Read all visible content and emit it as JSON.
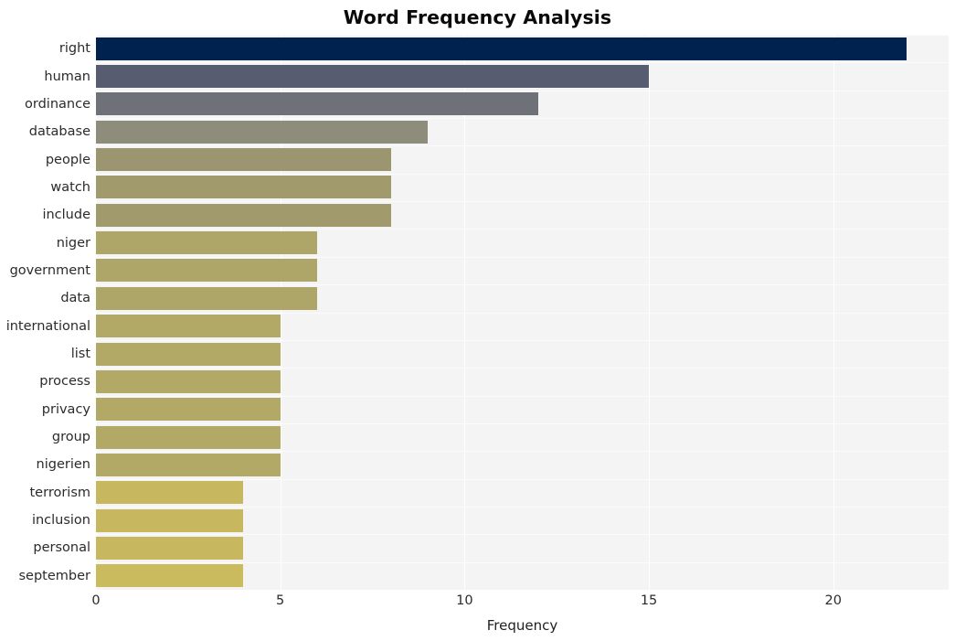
{
  "chart_data": {
    "type": "bar",
    "orientation": "horizontal",
    "title": "Word Frequency Analysis",
    "xlabel": "Frequency",
    "ylabel": "",
    "categories": [
      "right",
      "human",
      "ordinance",
      "database",
      "people",
      "watch",
      "include",
      "niger",
      "government",
      "data",
      "international",
      "list",
      "process",
      "privacy",
      "group",
      "nigerien",
      "terrorism",
      "inclusion",
      "personal",
      "september"
    ],
    "values": [
      22,
      15,
      12,
      9,
      8,
      8,
      8,
      6,
      6,
      6,
      5,
      5,
      5,
      5,
      5,
      5,
      4,
      4,
      4,
      4
    ],
    "bar_colors": [
      "#00224e",
      "#575c70",
      "#6f7178",
      "#8e8c7a",
      "#9b9670",
      "#a09a6d",
      "#a09a6d",
      "#aea569",
      "#aea569",
      "#aea569",
      "#b3a967",
      "#b3a967",
      "#b3a967",
      "#b3a967",
      "#b3a967",
      "#b3a967",
      "#c7b75f",
      "#c7b75f",
      "#c7b75f",
      "#cabb5e"
    ],
    "xticks": [
      "0",
      "5",
      "10",
      "15",
      "20"
    ],
    "xtick_values": [
      0,
      5,
      10,
      15,
      20
    ],
    "xlim": [
      0,
      23.13
    ],
    "grid": true,
    "grid_axis": "both",
    "legend": null,
    "plot_background": "#f4f4f4",
    "figure_background": "#ffffff",
    "text_color": "#2b2b2b"
  }
}
